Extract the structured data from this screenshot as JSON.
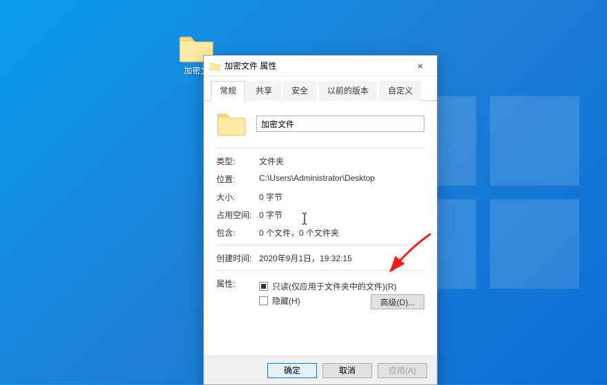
{
  "desktop": {
    "folder_label": "加密文"
  },
  "dialog": {
    "title": "加密文件 属性",
    "close": "×",
    "tabs": [
      "常规",
      "共享",
      "安全",
      "以前的版本",
      "自定义"
    ],
    "name_value": "加密文件",
    "rows": {
      "type_label": "类型:",
      "type_val": "文件夹",
      "loc_label": "位置:",
      "loc_val": "C:\\Users\\Administrator\\Desktop",
      "size_label": "大小:",
      "size_val": "0 字节",
      "disk_label": "占用空间:",
      "disk_val": "0 字节",
      "contains_label": "包含:",
      "contains_val": "0 个文件，0 个文件夹",
      "created_label": "创建时间:",
      "created_val": "2020年9月1日，19:32:15",
      "attr_label": "属性:",
      "readonly": "只读(仅应用于文件夹中的文件)(R)",
      "hidden": "隐藏(H)",
      "advanced": "高级(D)..."
    },
    "footer": {
      "ok": "确定",
      "cancel": "取消",
      "apply": "应用(A)"
    }
  }
}
